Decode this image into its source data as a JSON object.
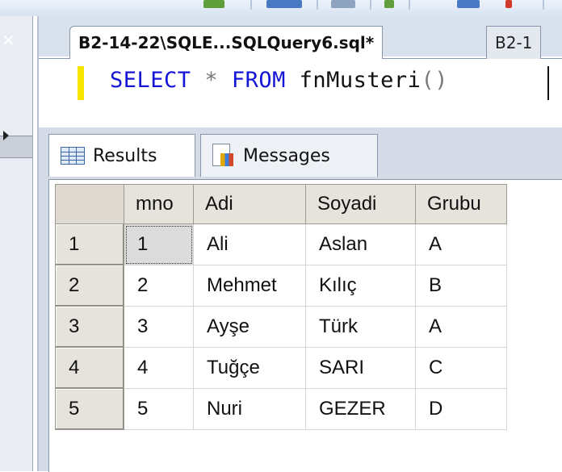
{
  "document_tabs": [
    {
      "label": "B2-14-22\\SQLE...SQLQuery6.sql*",
      "active": true
    },
    {
      "label": "B2-1",
      "active": false
    }
  ],
  "editor": {
    "keyword_select": "SELECT",
    "operator_star": "*",
    "keyword_from": "FROM",
    "function_name": "fnMusteri",
    "parens": "()"
  },
  "result_tabs": {
    "results_label": "Results",
    "messages_label": "Messages"
  },
  "grid": {
    "columns": [
      "mno",
      "Adi",
      "Soyadi",
      "Grubu"
    ],
    "rows": [
      {
        "row_number": "1",
        "mno": "1",
        "adi": "Ali",
        "soyadi": "Aslan",
        "grubu": "A"
      },
      {
        "row_number": "2",
        "mno": "2",
        "adi": "Mehmet",
        "soyadi": "Kılıç",
        "grubu": "B"
      },
      {
        "row_number": "3",
        "mno": "3",
        "adi": "Ayşe",
        "soyadi": "Türk",
        "grubu": "A"
      },
      {
        "row_number": "4",
        "mno": "4",
        "adi": "Tuğçe",
        "soyadi": "SARI",
        "grubu": "C"
      },
      {
        "row_number": "5",
        "mno": "5",
        "adi": "Nuri",
        "soyadi": "GEZER",
        "grubu": "D"
      }
    ]
  },
  "colors": {
    "sql_keyword": "#1515d8",
    "change_marker": "#f5e500",
    "header_bg": "#e6e3dc"
  }
}
